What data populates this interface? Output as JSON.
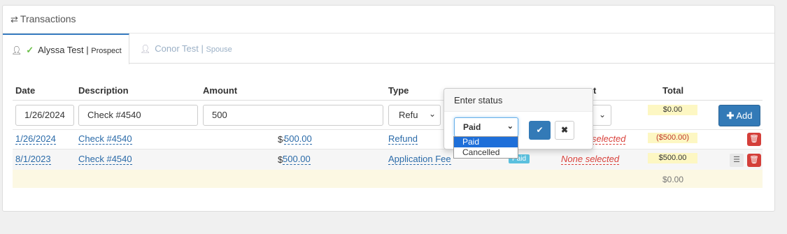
{
  "panel": {
    "title": "Transactions",
    "title_icon": "exchange-icon"
  },
  "tabs": [
    {
      "name": "Alyssa Test",
      "role": "Prospect",
      "active": true
    },
    {
      "name": "Conor Test",
      "role": "Spouse",
      "active": false
    }
  ],
  "columns": {
    "date": "Date",
    "description": "Description",
    "amount": "Amount",
    "type": "Type",
    "category": "t",
    "total": "Total"
  },
  "new_row": {
    "date": "1/26/2024",
    "description": "Check #4540",
    "amount": "500",
    "type": "Refu",
    "total": "$0.00",
    "add_label": "Add"
  },
  "rows": [
    {
      "date": "1/26/2024",
      "description": "Check #4540",
      "amount_prefix": "$-",
      "amount": "500.00",
      "type": "Refund",
      "category": "None selected",
      "category_visible": "selected",
      "total": "($500.00)"
    },
    {
      "date": "8/1/2023",
      "description": "Check #4540",
      "amount_prefix": "$",
      "amount": "500.00",
      "type": "Application Fee",
      "status": "Paid",
      "category": "None selected",
      "total": "$500.00"
    }
  ],
  "footer": {
    "total": "$0.00"
  },
  "popover": {
    "title": "Enter status",
    "selected": "Paid",
    "options": [
      "Paid",
      "Cancelled"
    ]
  },
  "colors": {
    "primary": "#337ab7",
    "danger": "#d43f3a",
    "highlight": "#fdf7c3",
    "info": "#5bc0de"
  }
}
